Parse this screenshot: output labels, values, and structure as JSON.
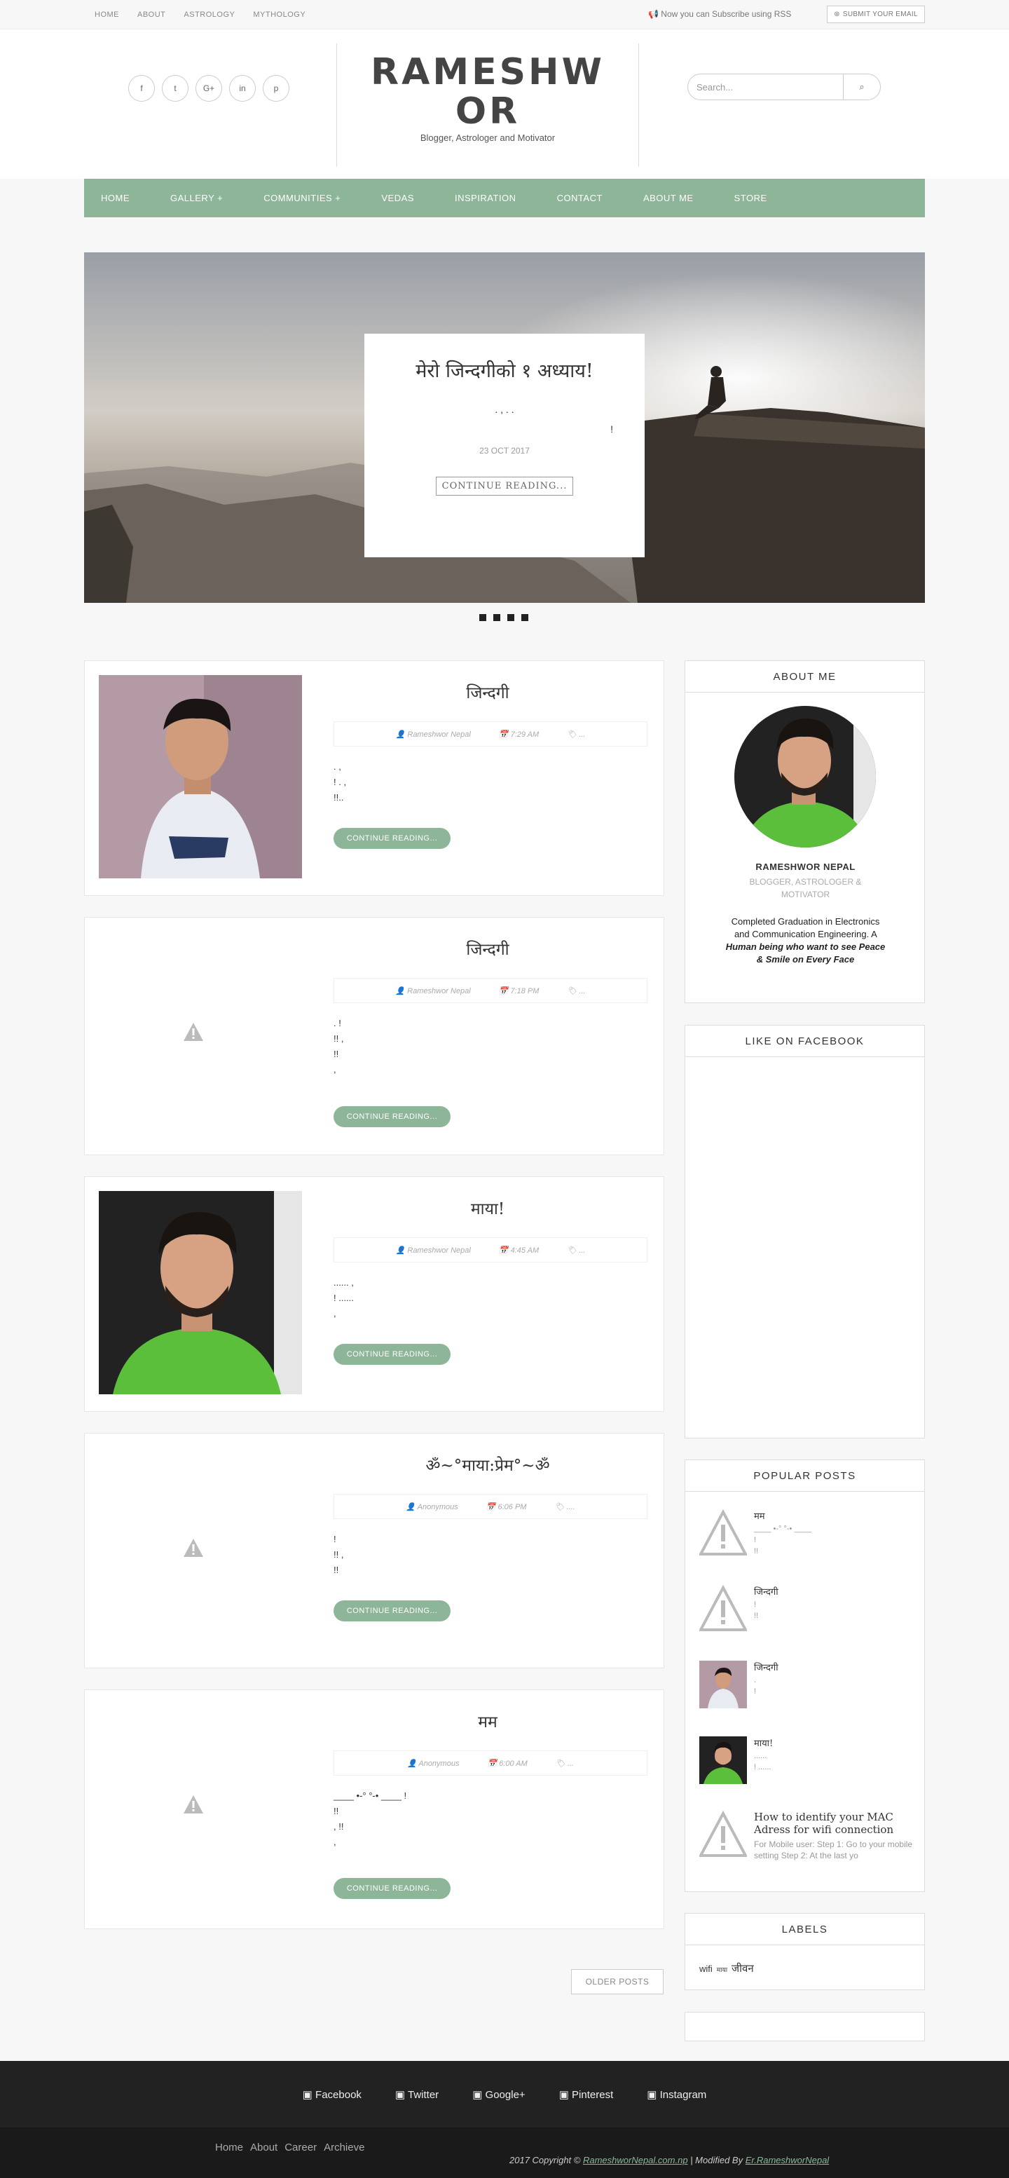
{
  "topbar": {
    "nav": [
      "HOME",
      "ABOUT",
      "ASTROLOGY",
      "MYTHOLOGY"
    ],
    "rss_text": "Now you can Subscribe using RSS",
    "subscribe_label": "SUBMIT YOUR EMAIL"
  },
  "header": {
    "title_line1": "RAMESHW",
    "title_line2": "OR",
    "tagline": "Blogger, Astrologer and Motivator",
    "search_placeholder": "Search..."
  },
  "social_icons": [
    "facebook-icon",
    "twitter-icon",
    "google-plus-icon",
    "linkedin-icon",
    "pinterest-icon"
  ],
  "main_nav": [
    "HOME",
    "GALLERY +",
    "COMMUNITIES +",
    "VEDAS",
    "INSPIRATION",
    "CONTACT",
    "ABOUT ME",
    "STORE"
  ],
  "slider": {
    "title": "मेरो जिन्दगीको १ अध्याय!",
    "excerpt_line1": ". , . .",
    "excerpt_line2": "!",
    "date": "23 OCT 2017",
    "button": "CONTINUE READING..."
  },
  "posts": [
    {
      "title": "जिन्दगी",
      "author": "Rameshwor Nepal",
      "time": "7:29 AM",
      "tag": "...",
      "excerpt": ". ,\n! . ,\n!!..",
      "button": "CONTINUE READING..."
    },
    {
      "title": "जिन्दगी",
      "author": "Rameshwor Nepal",
      "time": "7:18 PM",
      "tag": "...",
      "excerpt": ". !\n!! ,\n!!\n,",
      "button": "CONTINUE READING..."
    },
    {
      "title": "माया!",
      "author": "Rameshwor Nepal",
      "time": "4:45 AM",
      "tag": "...",
      "excerpt": "...... ,\n! ......\n,",
      "button": "CONTINUE READING..."
    },
    {
      "title": "ॐ~°माया:प्रेम°~ॐ",
      "author": "Anonymous",
      "time": "6:06 PM",
      "tag": "....",
      "excerpt": "!\n!! ,\n!!",
      "button": "CONTINUE READING..."
    },
    {
      "title": "मम",
      "author": "Anonymous",
      "time": "6:00 AM",
      "tag": "...",
      "excerpt": "____ •-° °-• ____ !\n!!\n, !!\n,",
      "button": "CONTINUE READING..."
    }
  ],
  "older_posts": "OLDER POSTS",
  "about": {
    "title": "ABOUT ME",
    "name": "RAMESHWOR NEPAL",
    "role": "BLOGGER, ASTROLOGER & MOTIVATOR",
    "desc_plain": "Completed Graduation in Electronics and Communication Engineering. A",
    "desc_emph": "Human being who want to see Peace & Smile on Every Face"
  },
  "facebook_widget": {
    "title": "LIKE ON FACEBOOK"
  },
  "popular": {
    "title": "POPULAR POSTS",
    "items": [
      {
        "title": "मम",
        "text": "____ •-° °-• ____\n!\n!!"
      },
      {
        "title": "जिन्दगी",
        "text": "!\n!!"
      },
      {
        "title": "जिन्दगी",
        "text": ".\n!"
      },
      {
        "title": "माया!",
        "text": "......\n! ......"
      },
      {
        "title": "How to identify your MAC Adress for wifi connection",
        "text": "For Mobile user: Step 1: Go to your mobile setting Step 2: At the last yo"
      }
    ]
  },
  "labels": {
    "title": "LABELS",
    "items": [
      "wifi",
      "माया",
      "जीवन"
    ]
  },
  "footer": {
    "links": [
      "Facebook",
      "Twitter",
      "Google+",
      "Pinterest",
      "Instagram"
    ],
    "bottom_links": [
      "Home",
      "About",
      "Career",
      "Archieve"
    ],
    "copyright_prefix": "2017 Copyright ©",
    "site": "RameshworNepal.com.np",
    "modified_prefix": "| Modified By",
    "author": "Er.RameshworNepal"
  }
}
